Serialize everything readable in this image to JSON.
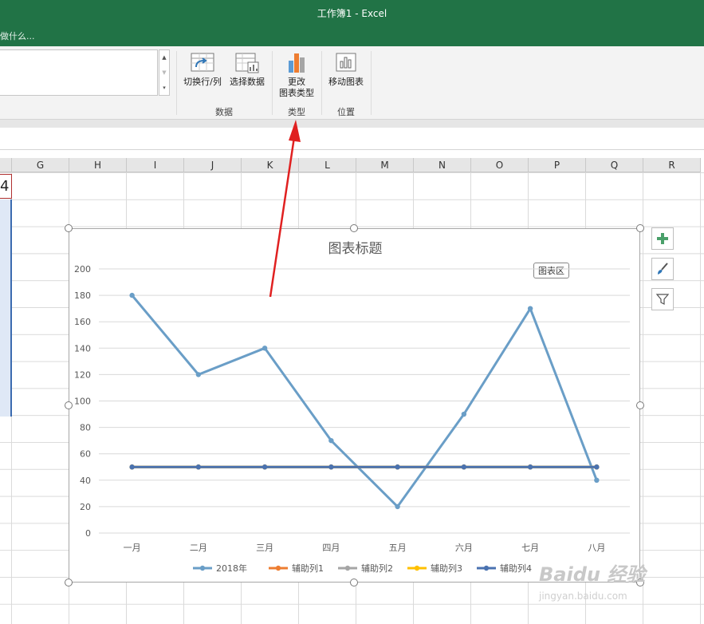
{
  "window": {
    "title": "工作簿1 - Excel",
    "tell_me": "做什么..."
  },
  "ribbon": {
    "buttons": {
      "switch_row_col": "切换行/列",
      "select_data": "选择数据",
      "change_type_line1": "更改",
      "change_type_line2": "图表类型",
      "move_chart": "移动图表"
    },
    "groups": {
      "data": "数据",
      "type": "类型",
      "location": "位置"
    }
  },
  "sheet": {
    "columns": [
      "G",
      "H",
      "I",
      "J",
      "K",
      "L",
      "M",
      "N",
      "O",
      "P",
      "Q",
      "R"
    ],
    "selected_cell_text": "4"
  },
  "chart": {
    "tooltip": "图表区"
  },
  "chart_data": {
    "type": "line",
    "title": "图表标题",
    "categories": [
      "一月",
      "二月",
      "三月",
      "四月",
      "五月",
      "六月",
      "七月",
      "八月"
    ],
    "ylim": [
      0,
      200
    ],
    "yticks": [
      0,
      20,
      40,
      60,
      80,
      100,
      120,
      140,
      160,
      180,
      200
    ],
    "grid": true,
    "legend_position": "bottom",
    "series": [
      {
        "name": "2018年",
        "color": "#6a9ec7",
        "values": [
          180,
          120,
          140,
          70,
          20,
          90,
          170,
          40
        ]
      },
      {
        "name": "辅助列1",
        "color": "#ed7d31",
        "values": [
          50,
          50,
          50,
          50,
          50,
          50,
          50,
          50
        ]
      },
      {
        "name": "辅助列2",
        "color": "#a5a5a5",
        "values": [
          50,
          50,
          50,
          50,
          50,
          50,
          50,
          50
        ]
      },
      {
        "name": "辅助列3",
        "color": "#ffc000",
        "values": [
          50,
          50,
          50,
          50,
          50,
          50,
          50,
          50
        ]
      },
      {
        "name": "辅助列4",
        "color": "#4a72b0",
        "values": [
          50,
          50,
          50,
          50,
          50,
          50,
          50,
          50
        ]
      }
    ]
  },
  "watermark": {
    "brand": "Baidu 经验",
    "url": "jingyan.baidu.com"
  }
}
